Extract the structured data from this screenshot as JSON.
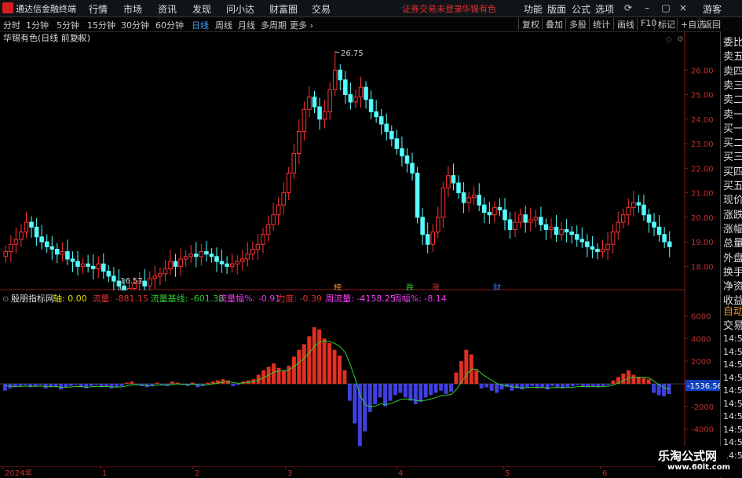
{
  "titlebar": {
    "app_name": "通达信金融终端",
    "menu": [
      "行情",
      "市场",
      "资讯",
      "发现",
      "问小达",
      "财富圈",
      "交易"
    ],
    "status": "证券交易未登录",
    "stock_name": "华锡有色",
    "right_menu": [
      "功能",
      "版面",
      "公式",
      "选项"
    ],
    "user": "游客"
  },
  "toolbar": {
    "periods": [
      "分时",
      "1分钟",
      "5分钟",
      "15分钟",
      "30分钟",
      "60分钟",
      "日线",
      "周线",
      "月线",
      "多周期",
      "更多 ›"
    ],
    "active_period": "日线",
    "right_buttons": [
      "复权",
      "叠加",
      "多股",
      "统计",
      "画线",
      "F10",
      "标记",
      "+自选",
      "返回"
    ]
  },
  "main_chart": {
    "title": "华锡有色(日线 前复权)",
    "high_label": "26.75",
    "low_label": "16.57",
    "y_ticks": [
      "26.00",
      "25.00",
      "24.00",
      "23.00",
      "22.00",
      "21.00",
      "20.00",
      "19.00",
      "18.00"
    ],
    "markers": [
      {
        "text": "榜",
        "color": "#e88a3a"
      },
      {
        "text": "跌",
        "color": "#30c030"
      },
      {
        "text": "涨",
        "color": "#e03030"
      },
      {
        "text": "财",
        "color": "#3a7ae8"
      }
    ]
  },
  "indicator": {
    "name": "殷朋指标网",
    "values": [
      {
        "label": "轴: 0.00",
        "color": "#e0e000"
      },
      {
        "label": "流量: -881.15",
        "color": "#e03030"
      },
      {
        "label": "流量基线: -601.38",
        "color": "#30d030"
      },
      {
        "label": "流量幅%: -0.91",
        "color": "#e040e0"
      },
      {
        "label": "力度: -0.39",
        "color": "#e03030"
      },
      {
        "label": "周流量: -4158.25",
        "color": "#ff40ff"
      },
      {
        "label": "周幅%: -8.14",
        "color": "#e040e0"
      }
    ],
    "y_ticks": [
      "6000",
      "4000",
      "2000",
      "0.00",
      "-2000",
      "-4000",
      "-6000"
    ],
    "current_value": "-1536.56"
  },
  "xaxis": {
    "labels": [
      "2024年",
      "1",
      "2",
      "3",
      "4",
      "5",
      "6"
    ]
  },
  "right_panel": {
    "items": [
      "委比",
      "卖五",
      "卖四",
      "卖三",
      "卖二",
      "卖一",
      "买一",
      "买二",
      "买三",
      "买四",
      "买五",
      "现价",
      "涨跌",
      "涨幅",
      "总量",
      "外盘",
      "换手",
      "净资",
      "收益"
    ],
    "bottom": [
      "自动",
      "交易"
    ],
    "times": [
      "14:56",
      "14:56",
      "14:56",
      "14:56",
      "14:56",
      "14:56",
      "14:56",
      "14:56",
      "14:56",
      "14:56"
    ]
  },
  "watermark": {
    "line1": "乐淘公式网",
    "line2": "www.60lt.com"
  },
  "chart_data": {
    "type": "candlestick",
    "y_range": [
      17.5,
      27.0
    ],
    "high": 26.75,
    "low": 16.57,
    "closes": [
      18.6,
      18.9,
      19.1,
      19.4,
      19.8,
      19.6,
      19.2,
      19.0,
      18.8,
      18.7,
      18.5,
      18.6,
      18.3,
      18.2,
      18.0,
      18.1,
      18.0,
      17.9,
      18.1,
      17.8,
      17.6,
      17.4,
      17.2,
      17.0,
      17.1,
      17.3,
      17.4,
      17.2,
      17.5,
      17.6,
      17.7,
      17.9,
      18.2,
      18.0,
      18.3,
      18.4,
      18.5,
      18.4,
      18.6,
      18.5,
      18.4,
      18.2,
      18.1,
      18.0,
      18.1,
      18.2,
      18.3,
      18.5,
      18.7,
      18.9,
      19.3,
      19.7,
      20.1,
      20.5,
      21.0,
      21.8,
      22.6,
      23.5,
      24.4,
      24.9,
      24.5,
      24.0,
      24.3,
      25.2,
      26.0,
      25.6,
      25.0,
      24.7,
      24.9,
      25.3,
      24.8,
      24.3,
      24.1,
      23.8,
      23.5,
      23.2,
      22.8,
      22.5,
      22.2,
      21.8,
      20.0,
      19.3,
      18.9,
      19.4,
      20.0,
      21.2,
      21.7,
      21.4,
      21.0,
      20.6,
      20.8,
      20.9,
      20.5,
      20.2,
      20.1,
      20.4,
      20.3,
      19.9,
      19.5,
      19.8,
      20.1,
      19.8,
      19.9,
      20.0,
      19.7,
      19.5,
      19.6,
      19.3,
      19.5,
      19.4,
      19.3,
      19.1,
      19.0,
      18.8,
      18.7,
      18.6,
      18.7,
      18.9,
      19.4,
      19.8,
      20.1,
      20.4,
      20.6,
      20.5,
      20.1,
      19.8,
      19.6,
      19.3,
      19.0,
      18.8
    ],
    "indicator_bars": [
      -600,
      -400,
      -300,
      -200,
      -100,
      -300,
      -200,
      -100,
      -400,
      -300,
      -200,
      -500,
      -300,
      -200,
      -100,
      -300,
      -400,
      -200,
      -100,
      -300,
      -200,
      -400,
      -300,
      -200,
      100,
      200,
      -100,
      -200,
      -300,
      -200,
      100,
      -100,
      -200,
      200,
      100,
      -100,
      -200,
      100,
      -300,
      -200,
      100,
      200,
      300,
      400,
      300,
      -200,
      -100,
      200,
      300,
      400,
      800,
      1200,
      1500,
      1800,
      1400,
      1200,
      1600,
      2400,
      3000,
      3500,
      4200,
      5000,
      4800,
      4000,
      3600,
      3000,
      2500,
      1200,
      -1500,
      -3500,
      -5500,
      -4200,
      -2500,
      -1800,
      -1200,
      -2000,
      -1500,
      -1000,
      -800,
      -1200,
      -1500,
      -1800,
      -1600,
      -1200,
      -1000,
      -800,
      -600,
      -900,
      -700,
      1000,
      2000,
      3000,
      2600,
      1200,
      -400,
      -300,
      -600,
      -800,
      -500,
      -300,
      -600,
      -400,
      -500,
      -300,
      -200,
      -400,
      -300,
      -500,
      -200,
      -300,
      -400,
      -300,
      -200,
      -100,
      -200,
      -300,
      -200,
      -300,
      -200,
      -100,
      300,
      600,
      900,
      1200,
      800,
      600,
      500,
      400,
      -800,
      -1000,
      -1100,
      -900
    ],
    "indicator_range": [
      -7000,
      7000
    ]
  }
}
